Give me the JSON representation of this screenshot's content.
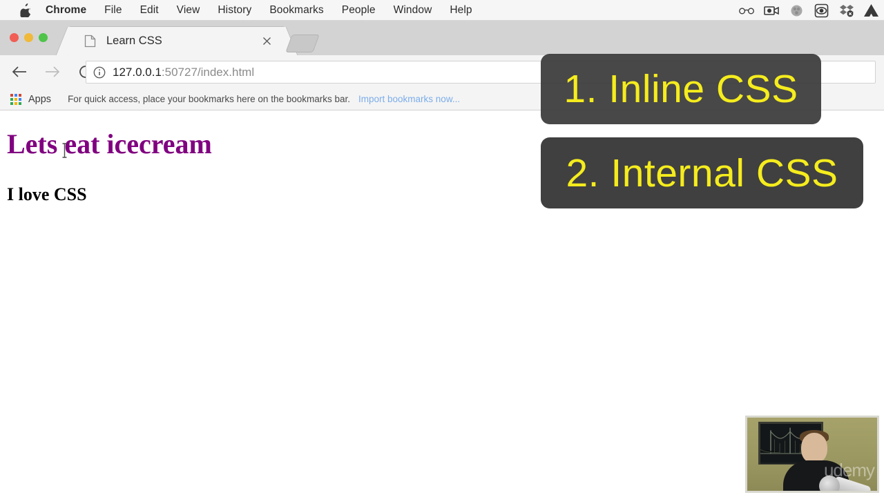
{
  "menubar": {
    "apple_icon": "apple-logo",
    "items": [
      {
        "label": "Chrome",
        "bold": true
      },
      {
        "label": "File",
        "bold": false
      },
      {
        "label": "Edit",
        "bold": false
      },
      {
        "label": "View",
        "bold": false
      },
      {
        "label": "History",
        "bold": false
      },
      {
        "label": "Bookmarks",
        "bold": false
      },
      {
        "label": "People",
        "bold": false
      },
      {
        "label": "Window",
        "bold": false
      },
      {
        "label": "Help",
        "bold": false
      }
    ],
    "status_icons": [
      "glasses-icon",
      "video-camera-icon",
      "circle-blur-icon",
      "screen-capture-icon",
      "dropbox-sync-icon",
      "google-drive-icon"
    ]
  },
  "browser": {
    "tab": {
      "title": "Learn CSS",
      "favicon": "document-icon",
      "close_icon": "close-icon"
    },
    "new_tab_button": "new-tab-button",
    "window_controls": [
      "close",
      "minimize",
      "maximize"
    ],
    "toolbar": {
      "back_icon": "back-arrow-icon",
      "forward_icon": "forward-arrow-icon",
      "reload_icon": "reload-icon",
      "omnibox": {
        "info_icon": "info-circle-icon",
        "url_host": "127.0.0.1",
        "url_rest": ":50727/index.html",
        "full_url": "127.0.0.1:50727/index.html"
      }
    },
    "bookmarks_bar": {
      "apps_icon": "apps-grid-icon",
      "apps_label": "Apps",
      "hint_text": "For quick access, place your bookmarks here on the bookmarks bar.",
      "import_link": "Import bookmarks now...",
      "link_color": "#7badea"
    }
  },
  "page": {
    "heading": "Lets eat icecream",
    "heading_color": "#800080",
    "paragraph": "I love CSS",
    "paragraph_color": "#000000",
    "cursor_icon": "text-cursor-icon"
  },
  "annotations": [
    {
      "id": "1",
      "text": "1. Inline CSS",
      "background": "#3a3a3a",
      "color": "#f5ec1d"
    },
    {
      "id": "2",
      "text": "2. Internal CSS",
      "background": "#3a3a3a",
      "color": "#f5ec1d"
    }
  ],
  "webcam": {
    "name": "presenter-webcam-overlay",
    "watermark": "udemy"
  }
}
